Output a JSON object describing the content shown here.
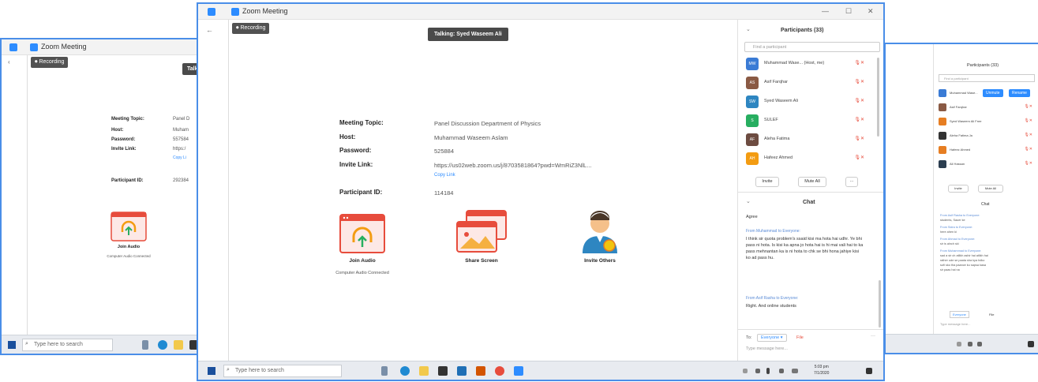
{
  "left_window": {
    "title": "Zoom Meeting",
    "recording": "Recording",
    "talking_fragment": "Talking",
    "meeting": {
      "topic_label": "Meeting Topic:",
      "topic_value": "Panel D",
      "host_label": "Host:",
      "host_value": "Muham",
      "password_label": "Password:",
      "password_value": "557584",
      "invite_label": "Invite Link:",
      "invite_value": "https:/",
      "copy_link": "Copy Li",
      "participant_label": "Participant ID:",
      "participant_value": "292384"
    },
    "join_audio": {
      "label": "Join Audio",
      "sub": "Computer Audio Connected"
    },
    "taskbar": {
      "search_placeholder": "Type here to search"
    }
  },
  "main_window": {
    "title": "Zoom Meeting",
    "recording": "Recording",
    "talking": "Talking: Syed Waseem Ali",
    "meeting": {
      "topic_label": "Meeting Topic:",
      "topic_value": "Panel Discussion Department of Physics",
      "host_label": "Host:",
      "host_value": "Muhammad Waseem Aslam",
      "password_label": "Password:",
      "password_value": "525884",
      "invite_label": "Invite Link:",
      "invite_value": "https://us02web.zoom.us/j/8703581864?pwd=WmRiZ3NlL...",
      "copy_link": "Copy Link",
      "participant_label": "Participant ID:",
      "participant_value": "114184"
    },
    "actions": [
      {
        "label": "Join Audio",
        "sub": "Computer Audio Connected"
      },
      {
        "label": "Share Screen",
        "sub": ""
      },
      {
        "label": "Invite Others",
        "sub": ""
      }
    ],
    "participants": {
      "header": "Participants (33)",
      "search_placeholder": "Find a participant",
      "items": [
        {
          "initials": "MW",
          "name": "Muhammad Wase... (Host, me)",
          "color": "#3a7bd5"
        },
        {
          "initials": "AS",
          "name": "Asif Farqhar",
          "color": "#8a5a44"
        },
        {
          "initials": "SW",
          "name": "Syed Waseem Ali",
          "color": "#2e86c1"
        },
        {
          "initials": "S",
          "name": "SULEF",
          "color": "#27ae60"
        },
        {
          "initials": "AF",
          "name": "Aleha Fatima",
          "color": "#6d4c41"
        },
        {
          "initials": "AH",
          "name": "Hafeez Ahmed",
          "color": "#f39c12"
        }
      ],
      "invite_btn": "Invite",
      "mute_btn": "Mute All",
      "more_btn": "..."
    },
    "chat": {
      "header": "Chat",
      "messages": [
        {
          "from": "",
          "text": "Agree"
        },
        {
          "from": "From Muhammad to Everyone:",
          "text": "I think sir quota problem's ssaid kisi ma hota hai udhr. Ye bhi pass ni hota. Is kisi ka apna jo hota hai is hi mai vali hai to ka pass mehnantan ka is ni hota to chk se bhi hona jahiye kisi ko ad pass hu."
        },
        {
          "from": "From Asif Rasha to Everyone:",
          "text": "Right. And online students"
        }
      ],
      "to_label": "To:",
      "to_value": "Everyone",
      "file_label": "File",
      "placeholder": "Type message here..."
    },
    "taskbar": {
      "search_placeholder": "Type here to search",
      "time": "5:03 pm",
      "date": "7/1/2020"
    }
  },
  "right_window": {
    "participants_header": "Participants (33)",
    "search_placeholder": "Find a participant",
    "items": [
      {
        "name": "Muhammad Wase...",
        "color": "#3a7bd5"
      },
      {
        "name": "Asif Farqhar",
        "color": "#8a5a44"
      },
      {
        "name": "Syed Waseem Ali Free",
        "color": "#e67e22"
      },
      {
        "name": "Aleha Fatima Ja",
        "color": "#333333"
      },
      {
        "name": "Hafeez Ahmed",
        "color": "#e67e22"
      },
      {
        "name": "Ali Hassan",
        "color": "#2c3e50"
      }
    ],
    "unmute_btn": "Unmute",
    "rename_btn": "Rename",
    "invite_btn": "Invite",
    "mute_btn": "Mute All",
    "chat_header": "Chat",
    "chat_lines": [
      "From Asif Rasha to Everyone:",
      "students, Sauer ke",
      "From Sidra to Everyone:",
      "here ahen ki",
      "From Ahmad to Everyone:",
      "sir is alnch ski",
      "From Muhammad to Everyone:",
      "sad a sir ch atlikh ashir hai atlikh hai",
      "rather ude se paata sha kya hdko",
      "sofi sko tha paance ku sapsa kasa",
      "sir paas hai na"
    ],
    "to_value": "Everyone",
    "file_label": "File",
    "placeholder": "Type message here..."
  }
}
